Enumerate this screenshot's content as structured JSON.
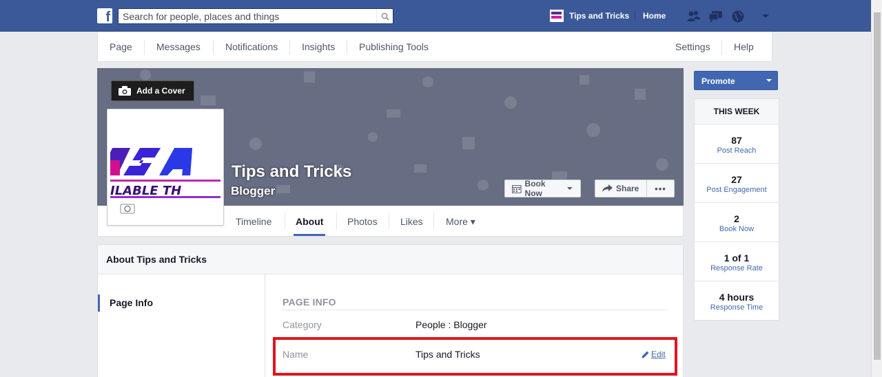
{
  "topbar": {
    "search_placeholder": "Search for people, places and things",
    "page_name": "Tips and Tricks",
    "home": "Home"
  },
  "admin_nav": {
    "items": [
      "Page",
      "Messages",
      "Notifications",
      "Insights",
      "Publishing Tools"
    ],
    "settings": "Settings",
    "help": "Help ▾"
  },
  "cover": {
    "add_cover": "Add a Cover",
    "page_name": "Tips and Tricks",
    "category": "Blogger",
    "book_now": "Book Now",
    "share": "Share",
    "more": "•••"
  },
  "profile_pic_text": "ILABLE TH",
  "timeline_tabs": {
    "timeline": "Timeline",
    "about": "About",
    "photos": "Photos",
    "likes": "Likes",
    "more": "More ▾"
  },
  "about": {
    "header": "About Tips and Tricks",
    "nav_page_info": "Page Info",
    "section_title": "PAGE INFO",
    "category_label": "Category",
    "category_value": "People : Blogger",
    "name_label": "Name",
    "name_value": "Tips and Tricks",
    "edit": "Edit"
  },
  "sidebar": {
    "promote": "Promote",
    "this_week": "THIS WEEK",
    "stats": [
      {
        "value": "87",
        "label": "Post Reach"
      },
      {
        "value": "27",
        "label": "Post Engagement"
      },
      {
        "value": "2",
        "label": "Book Now"
      },
      {
        "value": "1 of 1",
        "label": "Response Rate"
      },
      {
        "value": "4 hours",
        "label": "Response Time"
      }
    ]
  },
  "colors": {
    "brand_blue": "#3b5998",
    "link_blue": "#4267b2",
    "highlight_red": "#e0151e"
  }
}
